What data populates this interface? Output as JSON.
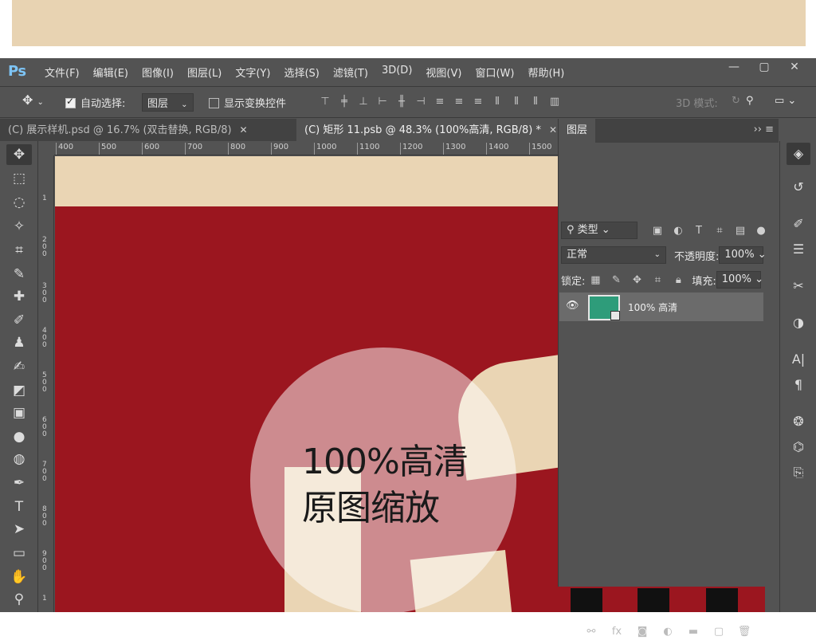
{
  "app": {
    "logo": "Ps"
  },
  "menu": [
    "文件(F)",
    "编辑(E)",
    "图像(I)",
    "图层(L)",
    "文字(Y)",
    "选择(S)",
    "滤镜(T)",
    "3D(D)",
    "视图(V)",
    "窗口(W)",
    "帮助(H)"
  ],
  "window_controls": {
    "minimize": "—",
    "maximize": "▢",
    "close": "✕"
  },
  "options": {
    "auto_select_label": "自动选择:",
    "auto_select_checked": true,
    "auto_select_value": "图层",
    "show_transform_label": "显示变换控件",
    "show_transform_checked": false,
    "mode_3d_label": "3D 模式:"
  },
  "tabs": [
    {
      "label": "(C) 展示样机.psd @ 16.7% (双击替换, RGB/8)",
      "active": false,
      "close": "✕"
    },
    {
      "label": "(C) 矩形 11.psb @ 48.3% (100%高清, RGB/8) *",
      "active": true,
      "close": "✕"
    }
  ],
  "ruler": {
    "top": [
      "400",
      "500",
      "600",
      "700",
      "800",
      "900",
      "1000",
      "1100",
      "1200",
      "1300",
      "1400",
      "1500"
    ],
    "left": [
      "1",
      "200",
      "300",
      "400",
      "500",
      "600",
      "700",
      "800",
      "900",
      "1"
    ]
  },
  "canvas": {
    "overlay_line1": "100%高清",
    "overlay_line2": "原图缩放",
    "colors": {
      "red": "#9b161f",
      "beige": "#ead5b4"
    }
  },
  "layers_panel": {
    "tab_label": "图层",
    "filter_label": "类型",
    "blend_mode": "正常",
    "opacity_label": "不透明度:",
    "opacity_value": "100%",
    "lock_label": "锁定:",
    "fill_label": "填充:",
    "fill_value": "100%",
    "layers": [
      {
        "name": "100% 高清",
        "visible": true,
        "thumb_color": "#2e9c7a"
      }
    ]
  }
}
